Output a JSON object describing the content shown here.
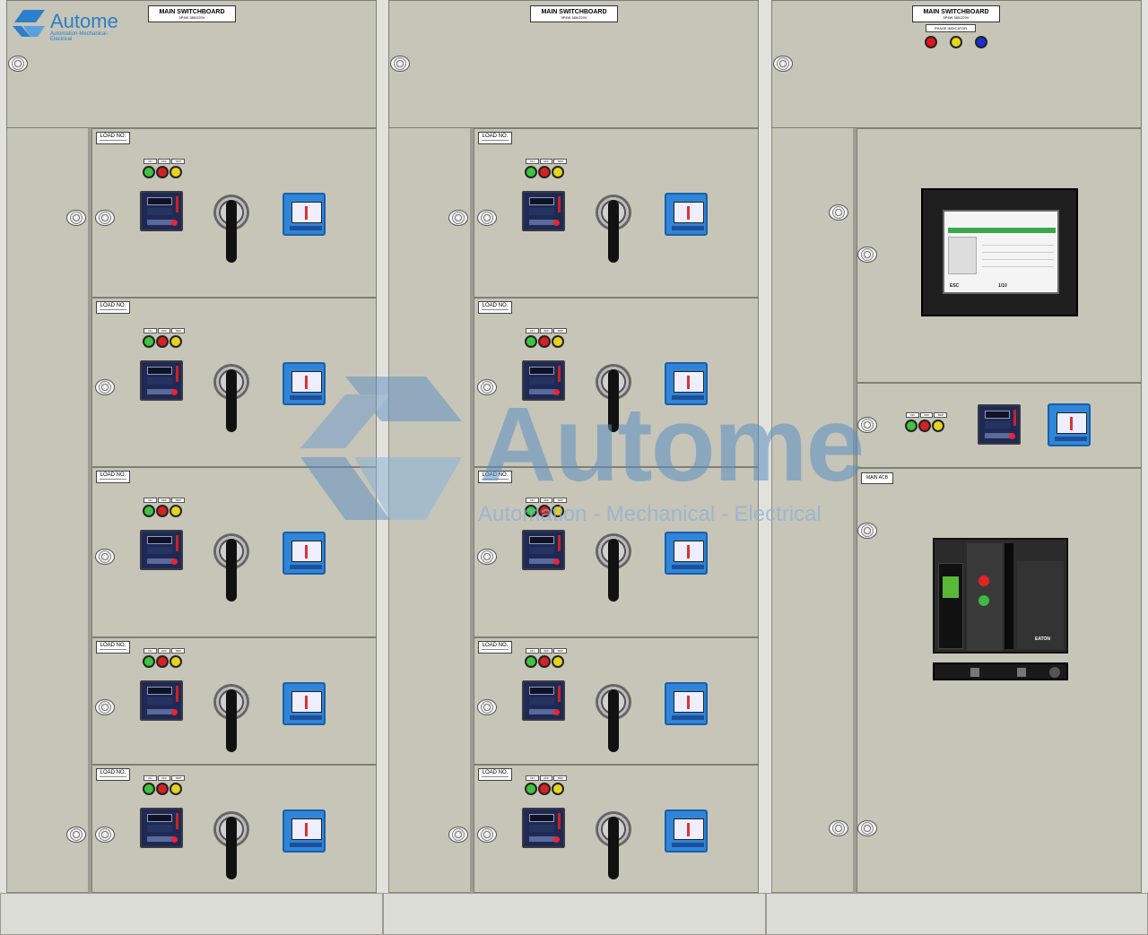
{
  "brand": {
    "name": "Autome",
    "tagline": "Automation-Mechanical-Electrical"
  },
  "watermark": {
    "name": "Automе",
    "tagline": "Automation - Mechanical - Electrical"
  },
  "switchboard": {
    "title": "MAIN SWITCHBOARD",
    "subtitle": "3P4W 380/220V"
  },
  "phase_indicator": {
    "label": "PHASE INDICATOR",
    "colors": [
      "#e0141a",
      "#e8d818",
      "#1a2ed8"
    ]
  },
  "load_label": "LOAD NO.",
  "lamp_caps": [
    "ON",
    "OFF",
    "TRIP"
  ],
  "lamp_colors": [
    "#3ec43e",
    "#d42121",
    "#e6d41c"
  ],
  "main_acb": {
    "label": "MAIN ACB",
    "brand": "EATON"
  },
  "hmi": {
    "esc": "ESC",
    "page": "1/10"
  }
}
